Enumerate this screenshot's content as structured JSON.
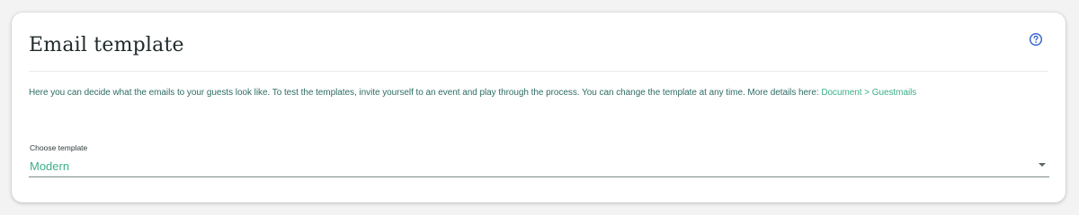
{
  "card": {
    "title": "Email template",
    "help_icon": "help-circle-icon",
    "description": {
      "text": "Here you can decide what the emails to your guests look like. To test the templates, invite yourself to an event and play through the process. You can change the template at any time. More details here: ",
      "link_text": "Document > Guestmails"
    },
    "template_select": {
      "label": "Choose template",
      "value": "Modern",
      "icon": "chevron-down-icon"
    }
  },
  "colors": {
    "accent": "#3dae8a",
    "help_icon": "#2f5fd0",
    "description_text": "#2e6d64",
    "title_text": "#1f2a2a"
  }
}
